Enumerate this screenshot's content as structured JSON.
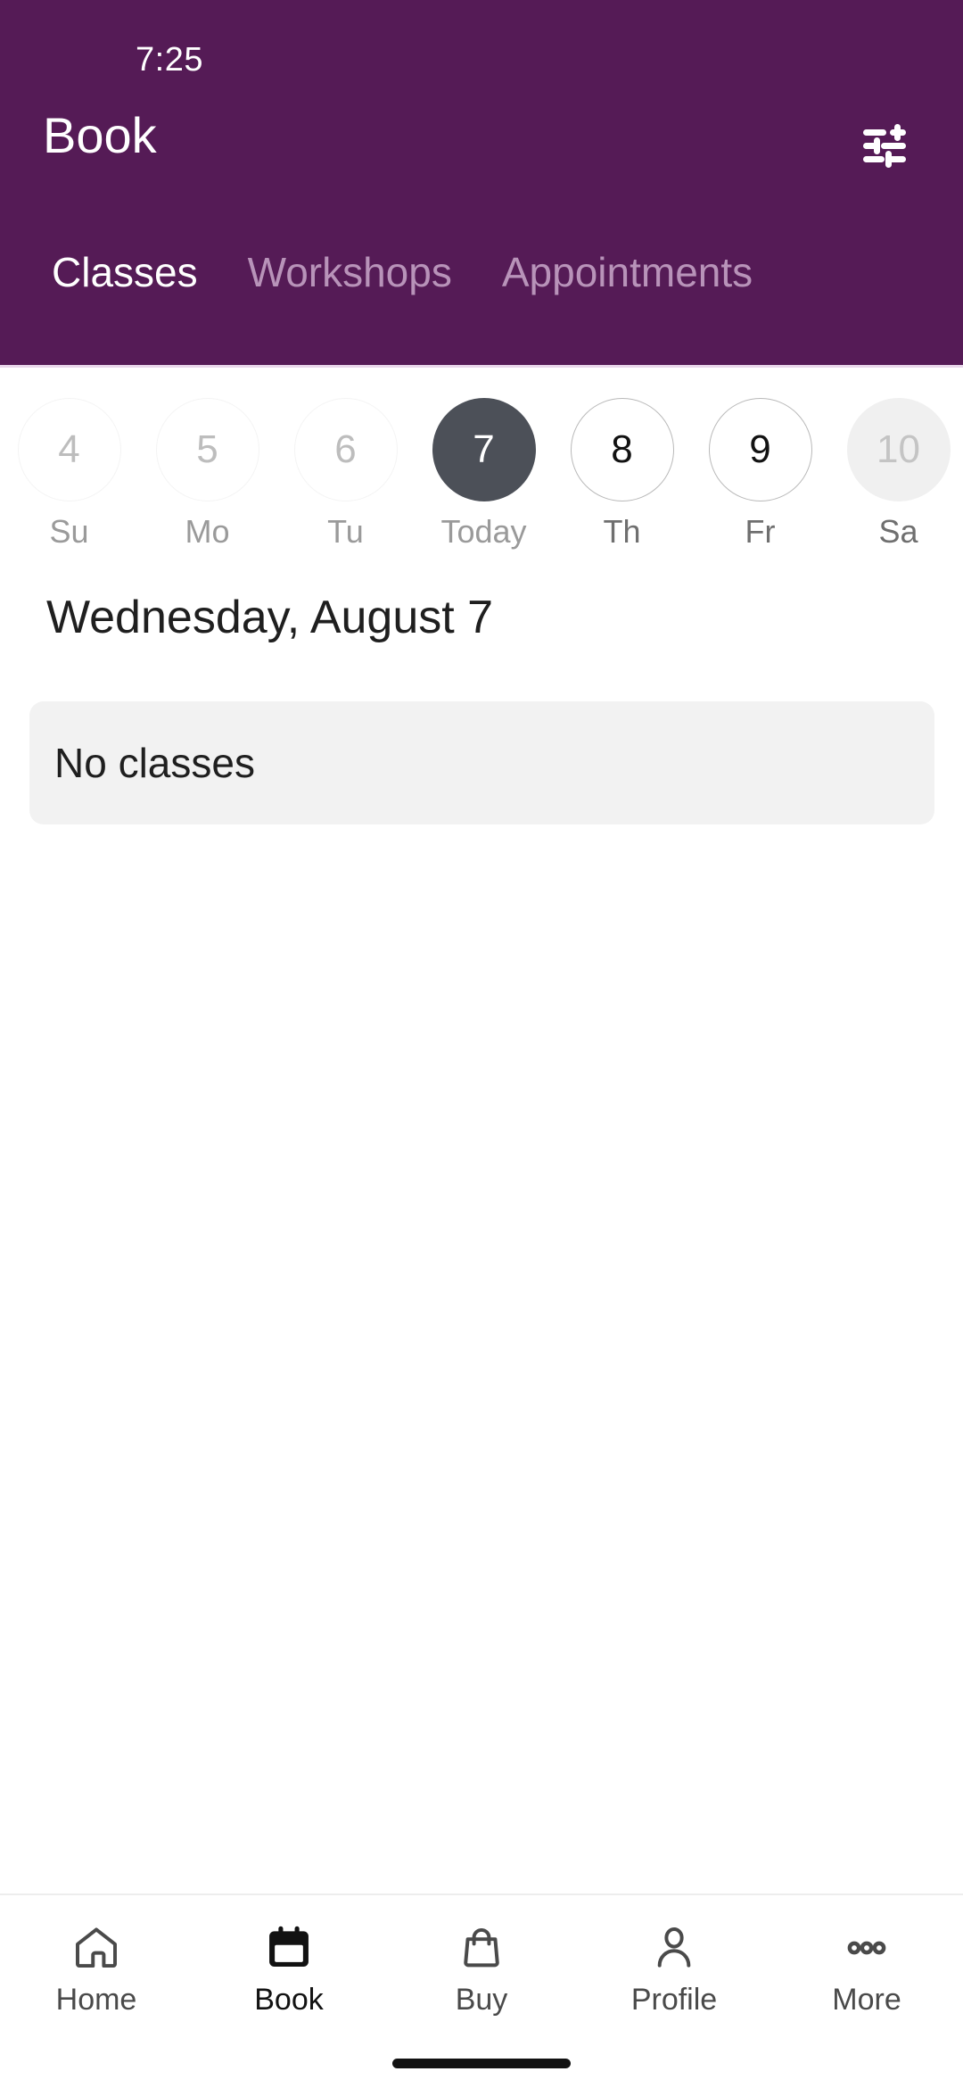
{
  "status_bar": {
    "time": "7:25"
  },
  "header": {
    "title": "Book",
    "accent_color": "#551B56",
    "filter_icon": "tune-icon",
    "tabs": [
      {
        "label": "Classes",
        "active": true
      },
      {
        "label": "Workshops",
        "active": false
      },
      {
        "label": "Appointments",
        "active": false
      }
    ]
  },
  "date_strip": {
    "days": [
      {
        "number": "4",
        "label": "Su",
        "state": "past"
      },
      {
        "number": "5",
        "label": "Mo",
        "state": "past"
      },
      {
        "number": "6",
        "label": "Tu",
        "state": "past"
      },
      {
        "number": "7",
        "label": "Today",
        "state": "selected"
      },
      {
        "number": "8",
        "label": "Th",
        "state": "future"
      },
      {
        "number": "9",
        "label": "Fr",
        "state": "future"
      },
      {
        "number": "10",
        "label": "Sa",
        "state": "muted-fill"
      }
    ]
  },
  "main": {
    "day_heading": "Wednesday, August 7",
    "empty_state": "No classes"
  },
  "bottom_nav": {
    "items": [
      {
        "label": "Home",
        "icon": "home-icon",
        "active": false
      },
      {
        "label": "Book",
        "icon": "calendar-icon",
        "active": true
      },
      {
        "label": "Buy",
        "icon": "bag-icon",
        "active": false
      },
      {
        "label": "Profile",
        "icon": "person-icon",
        "active": false
      },
      {
        "label": "More",
        "icon": "dots-icon",
        "active": false
      }
    ]
  }
}
